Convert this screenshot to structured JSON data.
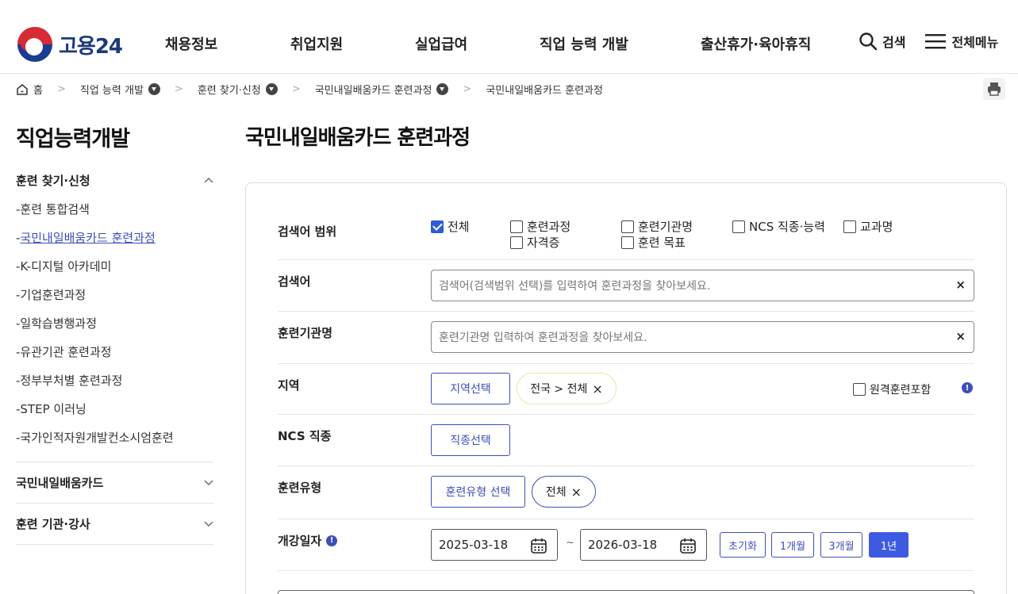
{
  "header": {
    "logo_text": "고용24",
    "nav": [
      "채용정보",
      "취업지원",
      "실업급여",
      "직업 능력 개발",
      "출산휴가·육아휴직"
    ],
    "search_label": "검색",
    "menu_label": "전체메뉴"
  },
  "breadcrumb": {
    "home": "홈",
    "items": [
      "직업 능력 개발",
      "훈련 찾기·신청",
      "국민내일배움카드 훈련과정",
      "국민내일배움카드 훈련과정"
    ]
  },
  "sidebar": {
    "title": "직업능력개발",
    "section1": "훈련 찾기·신청",
    "items": [
      "-훈련 통합검색",
      "국민내일배움카드 훈련과정",
      "-K-디지털 아카데미",
      "-기업훈련과정",
      "-일학습병행과정",
      "-유관기관 훈련과정",
      "-정부부처별 훈련과정",
      "-STEP 이러닝",
      "-국가인적자원개발컨소시엄훈련"
    ],
    "section2": "국민내일배움카드",
    "section3": "훈련 기관·강사"
  },
  "main": {
    "title": "국민내일배움카드 훈련과정",
    "scope_label": "검색어 범위",
    "scope_options": [
      "전체",
      "훈련과정",
      "훈련기관명",
      "NCS 직종·능력",
      "교과명",
      "자격증",
      "훈련 목표"
    ],
    "keyword_label": "검색어",
    "keyword_placeholder": "검색어(검색범위 선택)를 입력하여 훈련과정을 찾아보세요.",
    "institution_label": "훈련기관명",
    "institution_placeholder": "훈련기관명 입력하여 훈련과정을 찾아보세요.",
    "region_label": "지역",
    "region_button": "지역선택",
    "region_tag": "전국 > 전체",
    "remote_label": "원격훈련포함",
    "ncs_label": "NCS 직종",
    "ncs_button": "직종선택",
    "type_label": "훈련유형",
    "type_button": "훈련유형 선택",
    "type_tag": "전체",
    "date_label": "개강일자",
    "date_from": "2025-03-18",
    "date_sep": "~",
    "date_to": "2026-03-18",
    "period_buttons": [
      "초기화",
      "1개월",
      "3개월",
      "1년"
    ],
    "clear_symbol": "×"
  },
  "colors": {
    "accent": "#3d4fb8",
    "active_button": "#3d5ae0",
    "checkbox": "#2f5bd3"
  }
}
